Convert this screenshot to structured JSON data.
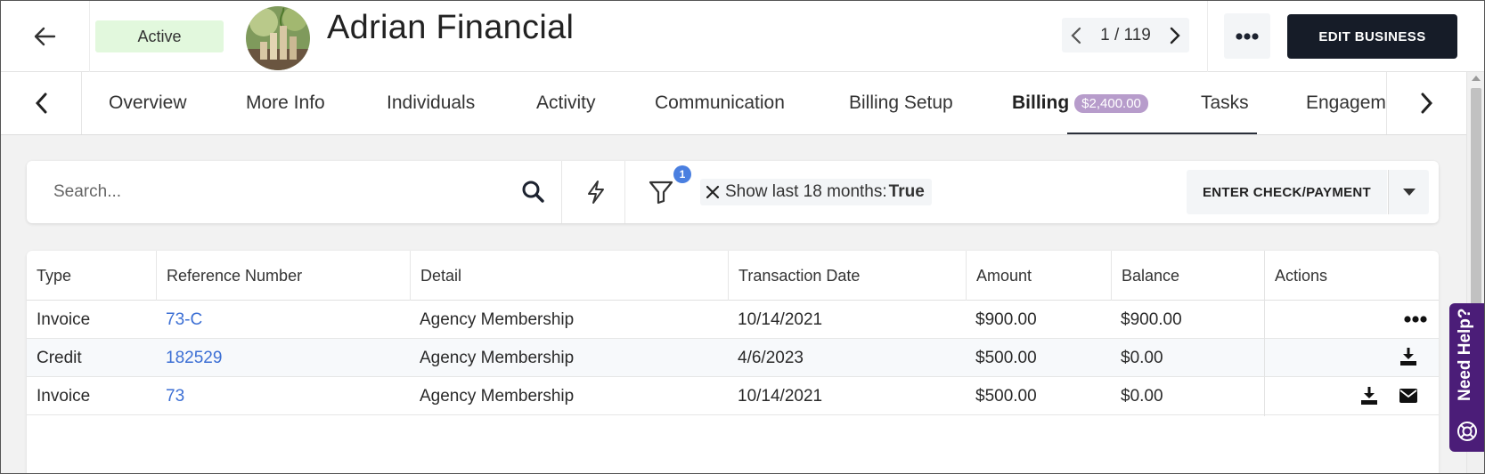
{
  "header": {
    "status": "Active",
    "business_name": "Adrian Financial",
    "pager": "1 / 119",
    "edit_button": "EDIT BUSINESS"
  },
  "tabs": [
    {
      "label": "Overview"
    },
    {
      "label": "More Info"
    },
    {
      "label": "Individuals"
    },
    {
      "label": "Activity"
    },
    {
      "label": "Communication"
    },
    {
      "label": "Billing Setup"
    },
    {
      "label": "Billing",
      "badge": "$2,400.00",
      "active": true
    },
    {
      "label": "Tasks"
    },
    {
      "label": "Engagem"
    }
  ],
  "filters": {
    "search_placeholder": "Search...",
    "filter_count": "1",
    "chip_label": "Show last 18 months:",
    "chip_value": "True",
    "enter_button": "ENTER CHECK/PAYMENT"
  },
  "table": {
    "columns": [
      "Type",
      "Reference Number",
      "Detail",
      "Transaction Date",
      "Amount",
      "Balance",
      "Actions"
    ],
    "rows": [
      {
        "type": "Invoice",
        "ref": "73-C",
        "detail": "Agency Membership",
        "date": "10/14/2021",
        "amount": "$900.00",
        "balance": "$900.00",
        "actions": [
          "more-icon"
        ]
      },
      {
        "type": "Credit",
        "ref": "182529",
        "detail": "Agency Membership",
        "date": "4/6/2023",
        "amount": "$500.00",
        "balance": "$0.00",
        "actions": [
          "download-icon"
        ]
      },
      {
        "type": "Invoice",
        "ref": "73",
        "detail": "Agency Membership",
        "date": "10/14/2021",
        "amount": "$500.00",
        "balance": "$0.00",
        "actions": [
          "download-icon",
          "envelope-icon"
        ]
      }
    ]
  },
  "help": {
    "label": "Need Help?"
  },
  "colors": {
    "accent_dark": "#161c28",
    "status_green_bg": "#e2f8dd",
    "badge_purple": "#b79ccb",
    "link_blue": "#3c6fd4",
    "help_purple": "#4b1d78"
  }
}
